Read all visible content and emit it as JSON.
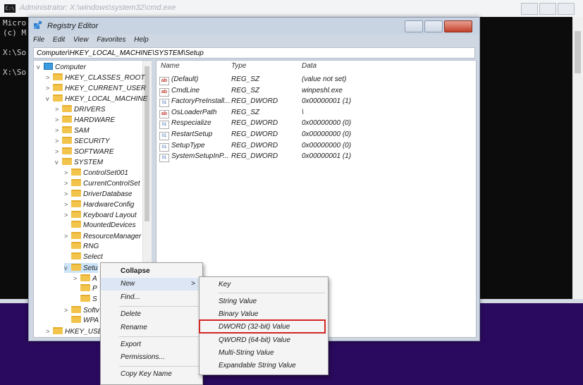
{
  "cmd": {
    "icon_text": "C:\\",
    "title": "Administrator: X:\\windows\\system32\\cmd.exe",
    "lines": [
      "Micro",
      "(c) M",
      "",
      "X:\\So",
      "",
      "X:\\So"
    ]
  },
  "regedit": {
    "title": "Registry Editor",
    "menu": [
      "File",
      "Edit",
      "View",
      "Favorites",
      "Help"
    ],
    "address": "Computer\\HKEY_LOCAL_MACHINE\\SYSTEM\\Setup",
    "tree": [
      {
        "label": "Computer",
        "chev": "v",
        "indent": 0,
        "type": "pc"
      },
      {
        "label": "HKEY_CLASSES_ROOT",
        "chev": ">",
        "indent": 1
      },
      {
        "label": "HKEY_CURRENT_USER",
        "chev": ">",
        "indent": 1
      },
      {
        "label": "HKEY_LOCAL_MACHINE",
        "chev": "v",
        "indent": 1
      },
      {
        "label": "DRIVERS",
        "chev": ">",
        "indent": 2
      },
      {
        "label": "HARDWARE",
        "chev": ">",
        "indent": 2
      },
      {
        "label": "SAM",
        "chev": ">",
        "indent": 2
      },
      {
        "label": "SECURITY",
        "chev": ">",
        "indent": 2
      },
      {
        "label": "SOFTWARE",
        "chev": ">",
        "indent": 2
      },
      {
        "label": "SYSTEM",
        "chev": "v",
        "indent": 2
      },
      {
        "label": "ControlSet001",
        "chev": ">",
        "indent": 3
      },
      {
        "label": "CurrentControlSet",
        "chev": ">",
        "indent": 3
      },
      {
        "label": "DriverDatabase",
        "chev": ">",
        "indent": 3
      },
      {
        "label": "HardwareConfig",
        "chev": ">",
        "indent": 3
      },
      {
        "label": "Keyboard Layout",
        "chev": ">",
        "indent": 3
      },
      {
        "label": "MountedDevices",
        "chev": "",
        "indent": 3
      },
      {
        "label": "ResourceManager",
        "chev": ">",
        "indent": 3
      },
      {
        "label": "RNG",
        "chev": "",
        "indent": 3
      },
      {
        "label": "Select",
        "chev": "",
        "indent": 3
      },
      {
        "label": "Setu",
        "chev": "v",
        "indent": 3,
        "selected": true
      },
      {
        "label": "A",
        "chev": ">",
        "indent": 4
      },
      {
        "label": "P",
        "chev": "",
        "indent": 4
      },
      {
        "label": "S",
        "chev": "",
        "indent": 4
      },
      {
        "label": "Softv",
        "chev": ">",
        "indent": 3
      },
      {
        "label": "WPA",
        "chev": "",
        "indent": 3
      },
      {
        "label": "HKEY_USE",
        "chev": ">",
        "indent": 1
      }
    ],
    "columns": {
      "name": "Name",
      "type": "Type",
      "data": "Data"
    },
    "values": [
      {
        "icon": "ab",
        "name": "(Default)",
        "type": "REG_SZ",
        "data": "(value not set)"
      },
      {
        "icon": "ab",
        "name": "CmdLine",
        "type": "REG_SZ",
        "data": "winpeshl.exe"
      },
      {
        "icon": "bin",
        "name": "FactoryPreInstall...",
        "type": "REG_DWORD",
        "data": "0x00000001 (1)"
      },
      {
        "icon": "ab",
        "name": "OsLoaderPath",
        "type": "REG_SZ",
        "data": "\\"
      },
      {
        "icon": "bin",
        "name": "Respecialize",
        "type": "REG_DWORD",
        "data": "0x00000000 (0)"
      },
      {
        "icon": "bin",
        "name": "RestartSetup",
        "type": "REG_DWORD",
        "data": "0x00000000 (0)"
      },
      {
        "icon": "bin",
        "name": "SetupType",
        "type": "REG_DWORD",
        "data": "0x00000000 (0)"
      },
      {
        "icon": "bin",
        "name": "SystemSetupInP...",
        "type": "REG_DWORD",
        "data": "0x00000001 (1)"
      }
    ]
  },
  "context_menu": {
    "items": [
      "Collapse",
      "New",
      "Find...",
      "Delete",
      "Rename",
      "Export",
      "Permissions...",
      "Copy Key Name"
    ],
    "submenu_arrow": ">"
  },
  "submenu": {
    "items": [
      "Key",
      "String Value",
      "Binary Value",
      "DWORD (32-bit) Value",
      "QWORD (64-bit) Value",
      "Multi-String Value",
      "Expandable String Value"
    ],
    "highlighted": "DWORD (32-bit) Value"
  },
  "colors": {
    "highlight_box": "#d42525",
    "desktop": "#2a0a5e"
  }
}
